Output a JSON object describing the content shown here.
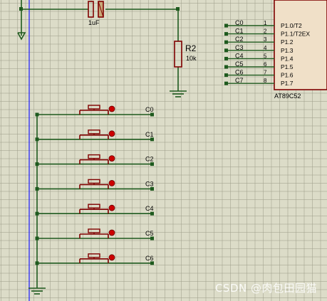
{
  "capacitor": {
    "value": "1uF"
  },
  "resistor": {
    "ref": "R2",
    "value": "10k"
  },
  "mcu": {
    "part": "AT89C52",
    "pins": [
      {
        "net": "C0",
        "num": "1",
        "name": "P1.0/T2"
      },
      {
        "net": "C1",
        "num": "2",
        "name": "P1.1/T2EX"
      },
      {
        "net": "C2",
        "num": "3",
        "name": "P1.2"
      },
      {
        "net": "C3",
        "num": "4",
        "name": "P1.3"
      },
      {
        "net": "C4",
        "num": "5",
        "name": "P1.4"
      },
      {
        "net": "C5",
        "num": "6",
        "name": "P1.5"
      },
      {
        "net": "C6",
        "num": "7",
        "name": "P1.6"
      },
      {
        "net": "C7",
        "num": "8",
        "name": "P1.7"
      }
    ]
  },
  "buttons": [
    {
      "net": "C0"
    },
    {
      "net": "C1"
    },
    {
      "net": "C2"
    },
    {
      "net": "C3"
    },
    {
      "net": "C4"
    },
    {
      "net": "C5"
    },
    {
      "net": "C6"
    }
  ],
  "watermark": "CSDN @肉包田园猫",
  "colors": {
    "wire": "#1e5a1e",
    "component": "#800000",
    "pin_dot": "#cc0000",
    "rail": "#1a1aff",
    "ic_fill": "#f0e0c8"
  }
}
